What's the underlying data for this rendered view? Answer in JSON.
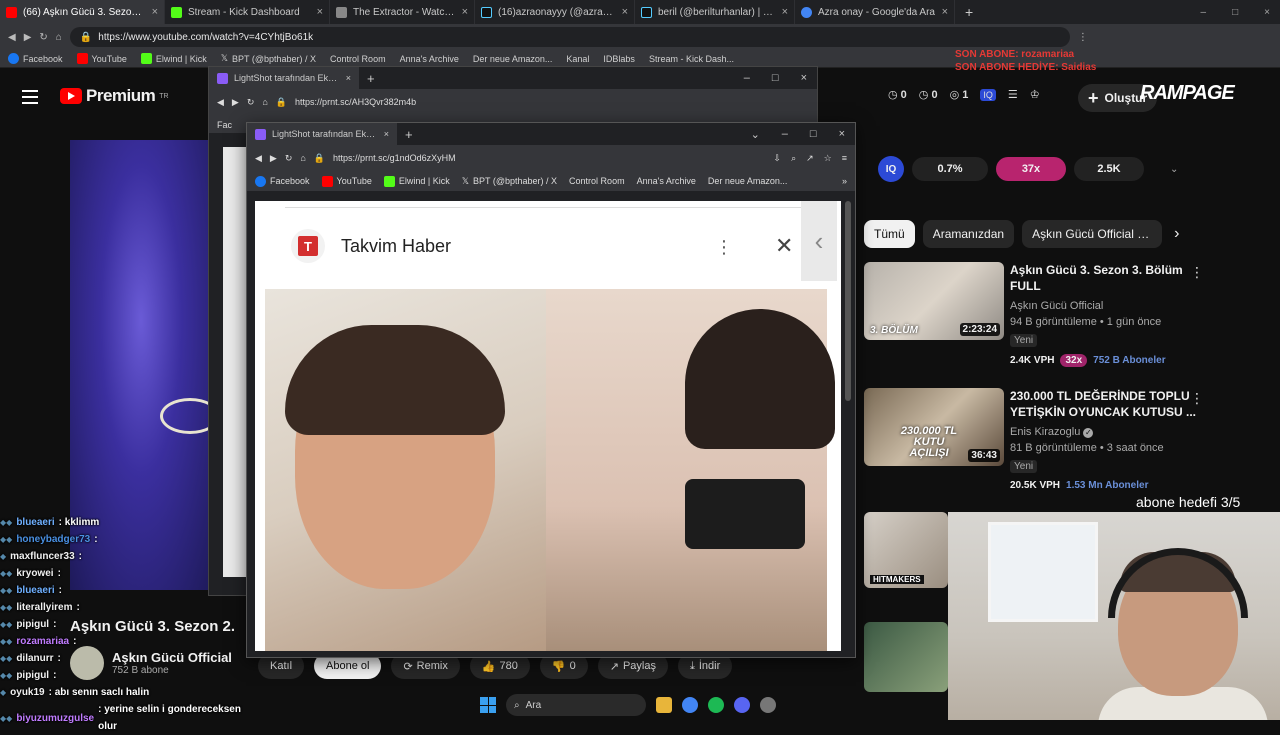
{
  "outer_tabs": [
    {
      "label": "(66) Aşkın Gücü 3. Sezon 2. Bölü",
      "color": "#ff0000",
      "active": true
    },
    {
      "label": "Stream - Kick Dashboard",
      "color": "#53fc18"
    },
    {
      "label": "The Extractor - Watch clips o",
      "color": "#888888"
    },
    {
      "label": "(16)azraonayyy (@azraonayyy) |",
      "color": "#ffffff"
    },
    {
      "label": "beril (@berilturhanlar) | TikTok",
      "color": "#ffffff"
    },
    {
      "label": "Azra onay - Google'da Ara",
      "color": "#4285f4"
    }
  ],
  "outer_url": "https://www.youtube.com/watch?v=4CYhtjBo61k",
  "outer_bookmarks": [
    "Facebook",
    "YouTube",
    "Elwind | Kick",
    "BPT (@bpthaber) / X",
    "Control Room",
    "Anna's Archive",
    "Der neue Amazon...",
    "Kanal",
    "IDBlabs",
    "Stream - Kick Dash..."
  ],
  "youtube": {
    "logo": "Premium",
    "region": "TR",
    "stats": [
      "0",
      "0",
      "1"
    ],
    "create_label": "Oluştur",
    "rampage": "RAMPAGE",
    "overlay_lines": [
      "SON ABONE: rozamariaa",
      "SON ABONE HEDİYE: Saidias"
    ],
    "iq": {
      "logo": "IQ",
      "pct": "0.7%",
      "ratio": "37x",
      "count": "2.5K"
    },
    "chips": [
      "Tümü",
      "Aramanızdan",
      "Aşkın Gücü Official adlı y"
    ],
    "videos": [
      {
        "title": "Aşkın Gücü 3. Sezon 3. Bölüm FULL",
        "channel": "Aşkın Gücü Official",
        "meta": "94 B görüntüleme • 1 gün önce",
        "badge": "Yeni",
        "duration": "2:23:24",
        "thumb_label": "3. BÖLÜM",
        "vph": "2.4K VPH",
        "ratio": "32x",
        "subs": "752 B Aboneler"
      },
      {
        "title": "230.000 TL DEĞERİNDE TOPLU YETİŞKİN OYUNCAK KUTUSU ...",
        "channel": "Enis Kirazoglu",
        "meta": "81 B görüntüleme • 3 saat önce",
        "badge": "Yeni",
        "duration": "36:43",
        "thumb_label": "230.000 TL KUTU AÇILIŞI",
        "vph": "20.5K VPH",
        "subs": "1.53 Mn Aboneler"
      }
    ],
    "third_thumb_label": "HITMAKERS",
    "abone_hedefi": "abone hedefi 3/5",
    "video_title": "Aşkın Gücü 3. Sezon 2.",
    "channel_name": "Aşkın Gücü Official",
    "channel_subs": "752 B abone",
    "actions": [
      "Katıl",
      "Abone ol",
      "Remix",
      "780",
      "0",
      "Paylaş",
      "İndir"
    ]
  },
  "chat": [
    {
      "user": "blueaeri",
      "msg": "kklimm",
      "color": "#6fb0ff"
    },
    {
      "user": "honeybadger73",
      "msg": "",
      "color": "#4a90e2"
    },
    {
      "user": "maxfluncer33",
      "msg": "",
      "color": "#ffffff"
    },
    {
      "user": "kryowei",
      "msg": "",
      "color": "#ffffff"
    },
    {
      "user": "blueaeri",
      "msg": "",
      "color": "#6fb0ff"
    },
    {
      "user": "literallyirem",
      "msg": "",
      "color": "#ffffff"
    },
    {
      "user": "pipigul",
      "msg": "",
      "color": "#ffffff"
    },
    {
      "user": "rozamariaa",
      "msg": "",
      "color": "#c07cff"
    },
    {
      "user": "dilanurr",
      "msg": "",
      "color": "#ffffff"
    },
    {
      "user": "pipigul",
      "msg": "",
      "color": "#ffffff"
    },
    {
      "user": "oyuk19",
      "msg": "abı senın saclı halin",
      "color": "#ffffff"
    },
    {
      "user": "biyuzumuzgulse",
      "msg": "yerine selin i gondereceksen olur",
      "color": "#c07cff"
    }
  ],
  "taskbar": {
    "search": "Ara"
  },
  "win1": {
    "tab": "LightShot tarafından Ekran Görü",
    "url": "https://prnt.sc/AH3Qvr382m4b",
    "peek": "Fac"
  },
  "win2": {
    "tab": "LightShot tarafından Ekran Görü",
    "url": "https://prnt.sc/g1ndOd6zXyHM",
    "bookmarks": [
      "Facebook",
      "YouTube",
      "Elwind | Kick",
      "BPT (@bpthaber) / X",
      "Control Room",
      "Anna's Archive",
      "Der neue Amazon..."
    ],
    "card_title": "Takvim Haber",
    "logo_letter": "T"
  }
}
